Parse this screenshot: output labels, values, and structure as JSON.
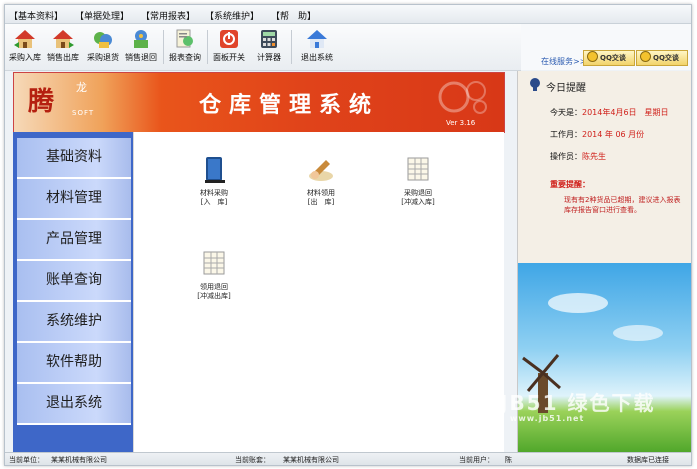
{
  "menubar": {
    "items": [
      "【基本资料】",
      "【单据处理】",
      "【常用报表】",
      "【系统维护】",
      "【帮　助】"
    ]
  },
  "toolbar": {
    "buttons": [
      {
        "label": "采购入库",
        "icon": "house-in-icon"
      },
      {
        "label": "销售出库",
        "icon": "house-out-icon"
      },
      {
        "label": "采购退货",
        "icon": "return-purchase-icon"
      },
      {
        "label": "销售退回",
        "icon": "return-sale-icon"
      },
      {
        "label": "报表查询",
        "icon": "report-query-icon"
      },
      {
        "label": "面板开关",
        "icon": "power-icon"
      },
      {
        "label": "计算器",
        "icon": "calculator-icon"
      },
      {
        "label": "退出系统",
        "icon": "exit-house-icon"
      }
    ]
  },
  "online_service": {
    "label": "在线服务>>",
    "qq1": "QQ交谈",
    "qq2": "QQ交谈"
  },
  "banner": {
    "logo": "腾",
    "logo_sub": "龙",
    "logo_soft": "SOFT",
    "title": "仓库管理系统",
    "version": "Ver 3.16"
  },
  "leftnav": {
    "items": [
      "基础资料",
      "材料管理",
      "产品管理",
      "账单查询",
      "系统维护",
      "软件帮助",
      "退出系统"
    ]
  },
  "content": {
    "items": [
      {
        "line1": "材料采购",
        "line2": "[入　库]"
      },
      {
        "line1": "材料领用",
        "line2": "[出　库]"
      },
      {
        "line1": "采购退回",
        "line2": "[冲减入库]"
      },
      {
        "line1": "领用退回",
        "line2": "[冲减出库]"
      }
    ]
  },
  "reminder": {
    "title": "今日提醒",
    "today_label": "今天是：",
    "today_value": "2014年4月6日　星期日",
    "month_label": "工作月：",
    "month_value": "2014 年 06 月份",
    "operator_label": "操作员：",
    "operator_value": "陈先生",
    "notice_title": "重要提醒：",
    "notice_text": "现有有2种货品已超期，建议进入报表库存报告窗口进行查看。"
  },
  "statusbar": {
    "unit_label": "当前单位：",
    "unit_value": "某某机械有限公司",
    "account_label": "当前账套：",
    "account_value": "某某机械有限公司",
    "user_label": "当前用户：",
    "user_value": "陈",
    "db_status": "数据库已连接"
  },
  "watermark": {
    "text": "JB51 绿色下载",
    "sub": "www.jb51.net"
  }
}
